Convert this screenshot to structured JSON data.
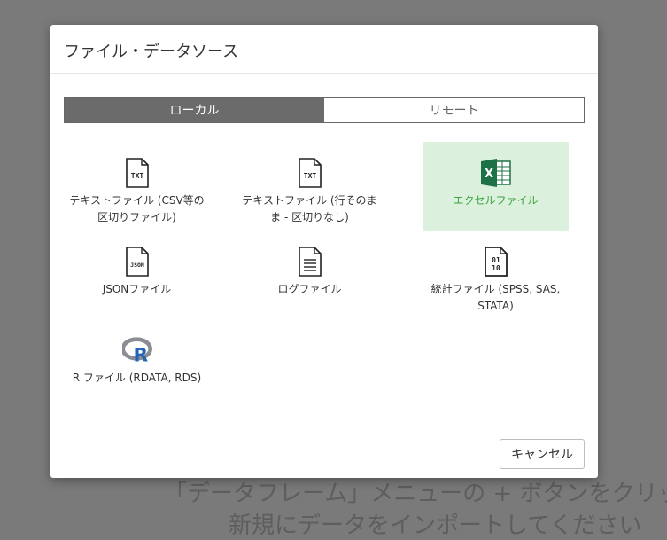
{
  "background": {
    "line1": "「データフレーム」メニューの + ボタンをクリッ",
    "line2": "新規にデータをインポートしてください"
  },
  "dialog": {
    "title": "ファイル・データソース",
    "tabs": [
      {
        "label": "ローカル",
        "active": true
      },
      {
        "label": "リモート",
        "active": false
      }
    ],
    "items": [
      {
        "label": "テキストファイル (CSV等の区切りファイル)",
        "icon": "txt-file-icon",
        "badge": "TXT"
      },
      {
        "label": "テキストファイル (行そのまま - 区切りなし)",
        "icon": "txt-file-icon",
        "badge": "TXT"
      },
      {
        "label": "エクセルファイル",
        "icon": "excel-icon",
        "badge": "X",
        "selected": true
      },
      {
        "label": "JSONファイル",
        "icon": "json-file-icon",
        "badge": "JSON"
      },
      {
        "label": "ログファイル",
        "icon": "log-file-icon"
      },
      {
        "label": "統計ファイル (SPSS, SAS, STATA)",
        "icon": "binary-file-icon",
        "badge": "01 10"
      },
      {
        "label": "R ファイル (RDATA, RDS)",
        "icon": "r-logo-icon",
        "badge": "R"
      }
    ],
    "cancel_label": "キャンセル"
  },
  "colors": {
    "selected_bg": "#dbf0dd",
    "selected_text": "#3ea33e",
    "excel_green": "#1e7145",
    "r_blue": "#2165b6",
    "tab_active": "#6b6b6b"
  }
}
